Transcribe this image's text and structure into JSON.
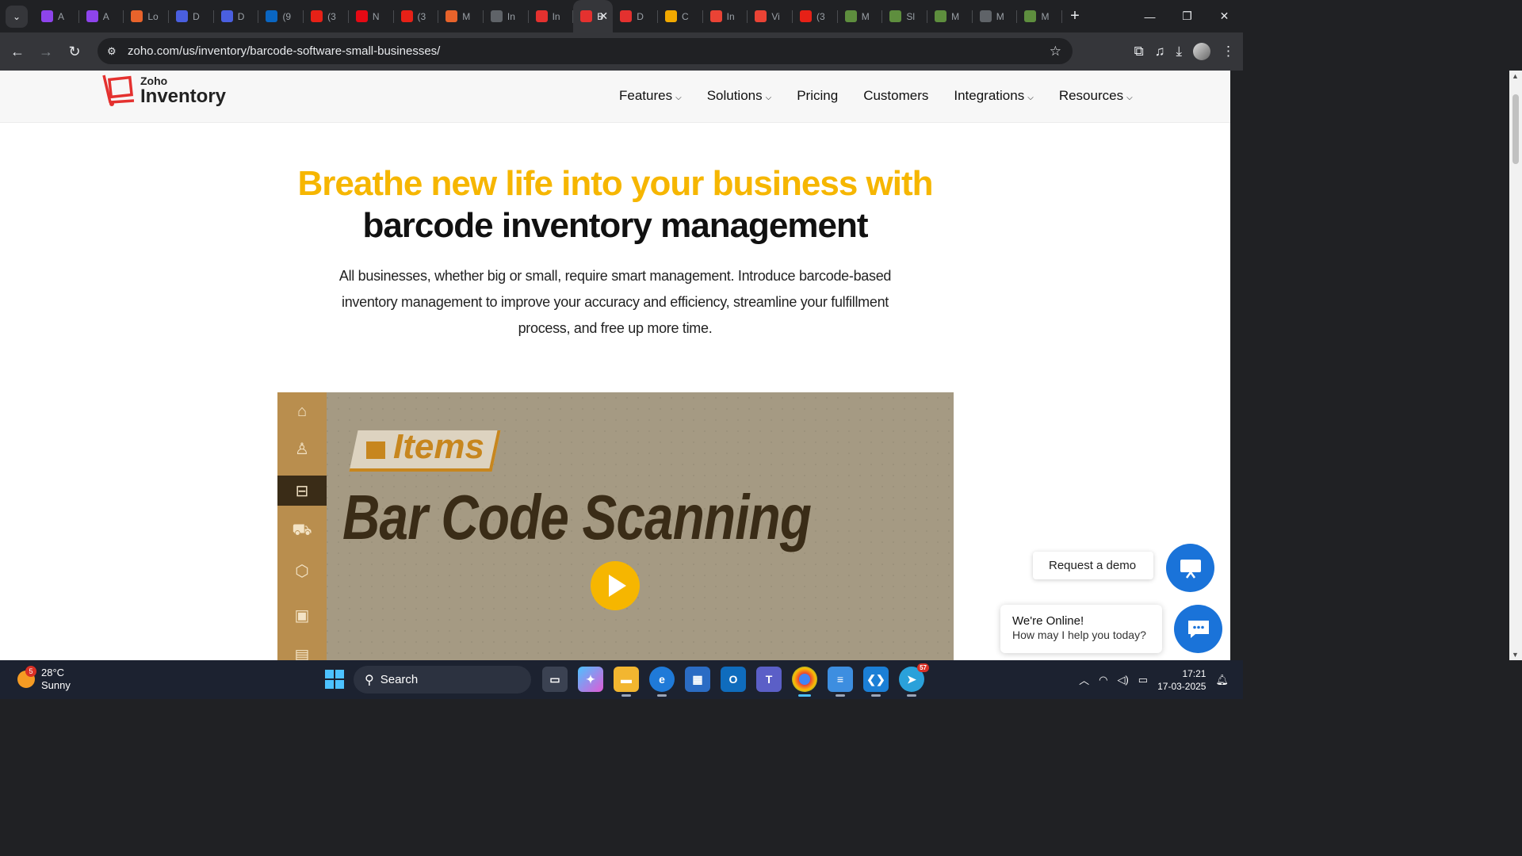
{
  "browser": {
    "tabs": [
      {
        "label": "A",
        "icon": "uptime-icon",
        "color": "#8e44ec"
      },
      {
        "label": "A",
        "icon": "uptime-icon",
        "color": "#8e44ec"
      },
      {
        "label": "Lo",
        "icon": "loom-icon",
        "color": "#e8632b"
      },
      {
        "label": "D",
        "icon": "webflow-icon",
        "color": "#4a5fe0"
      },
      {
        "label": "D",
        "icon": "webflow-icon",
        "color": "#4a5fe0"
      },
      {
        "label": "(9",
        "icon": "linkedin-icon",
        "color": "#0a66c2"
      },
      {
        "label": "(3",
        "icon": "youtube-icon",
        "color": "#e62117"
      },
      {
        "label": "N",
        "icon": "netflix-icon",
        "color": "#e50914"
      },
      {
        "label": "(3",
        "icon": "youtube-icon",
        "color": "#e62117"
      },
      {
        "label": "M",
        "icon": "make-icon",
        "color": "#e8632b"
      },
      {
        "label": "In",
        "icon": "globe-icon",
        "color": "#5f6368"
      },
      {
        "label": "In",
        "icon": "zoho-icon",
        "color": "#e4312f"
      },
      {
        "label": "B",
        "icon": "zoho-icon",
        "color": "#e4312f",
        "active": true
      },
      {
        "label": "D",
        "icon": "calendar-icon",
        "color": "#e4312f"
      },
      {
        "label": "C",
        "icon": "box-icon",
        "color": "#f2a900"
      },
      {
        "label": "In",
        "icon": "gmail-icon",
        "color": "#ea4335"
      },
      {
        "label": "Vi",
        "icon": "gmail-icon",
        "color": "#ea4335"
      },
      {
        "label": "(3",
        "icon": "youtube-icon",
        "color": "#e62117"
      },
      {
        "label": "M",
        "icon": "shopify-icon",
        "color": "#5e8e3e"
      },
      {
        "label": "Sl",
        "icon": "shopify-icon",
        "color": "#5e8e3e"
      },
      {
        "label": "M",
        "icon": "shopify-icon",
        "color": "#5e8e3e"
      },
      {
        "label": "M",
        "icon": "globe-icon",
        "color": "#5f6368"
      },
      {
        "label": "M",
        "icon": "shopify-icon",
        "color": "#5e8e3e"
      }
    ],
    "url": "zoho.com/us/inventory/barcode-software-small-businesses/"
  },
  "site": {
    "logo_brand": "Zoho",
    "logo_product": "Inventory",
    "nav": [
      {
        "label": "Features",
        "dropdown": true
      },
      {
        "label": "Solutions",
        "dropdown": true
      },
      {
        "label": "Pricing",
        "dropdown": false
      },
      {
        "label": "Customers",
        "dropdown": false
      },
      {
        "label": "Integrations",
        "dropdown": true
      },
      {
        "label": "Resources",
        "dropdown": true
      }
    ],
    "accent": "#f6b600"
  },
  "hero": {
    "title_line1": "Breathe new life into your business with",
    "title_line2": "barcode inventory management",
    "description": "All businesses, whether big or small, require smart management. Introduce barcode-based inventory management to improve your accuracy and efficiency, streamline your fulfillment process, and free up more time."
  },
  "video": {
    "tag": "Items",
    "title": "Bar Code Scanning",
    "sidebar_icons": [
      "home-icon",
      "user-icon",
      "basket-icon",
      "cart-icon",
      "package-icon",
      "bag-icon",
      "document-icon"
    ]
  },
  "widgets": {
    "demo_label": "Request a demo",
    "chat_title": "We're Online!",
    "chat_subtitle": "How may I help you today?"
  },
  "taskbar": {
    "weather_temp": "28°C",
    "weather_desc": "Sunny",
    "weather_badge": "5",
    "search_label": "Search",
    "telegram_badge": "57",
    "time": "17:21",
    "date": "17-03-2025"
  }
}
